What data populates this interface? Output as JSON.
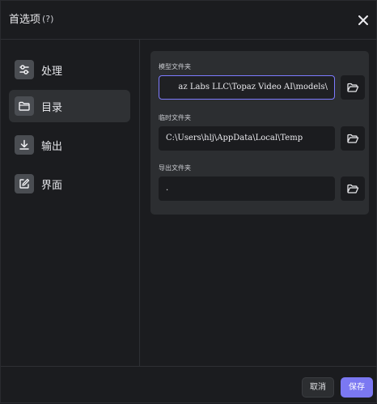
{
  "dialog": {
    "title": "首选项",
    "help": "(?)"
  },
  "sidebar": {
    "items": [
      {
        "label": "处理",
        "icon": "sliders-icon",
        "active": false
      },
      {
        "label": "目录",
        "icon": "folder-icon",
        "active": true
      },
      {
        "label": "输出",
        "icon": "download-icon",
        "active": false
      },
      {
        "label": "界面",
        "icon": "edit-square-icon",
        "active": false
      }
    ]
  },
  "directories": {
    "model_folder": {
      "label": "模型文件夹",
      "value": "az Labs LLC\\Topaz Video AI\\models\\"
    },
    "temp_folder": {
      "label": "临时文件夹",
      "value": "C:\\Users\\hlj\\AppData\\Local\\Temp"
    },
    "export_folder": {
      "label": "导出文件夹",
      "value": "."
    }
  },
  "footer": {
    "cancel_label": "取消",
    "save_label": "保存"
  },
  "colors": {
    "background": "#1b1c1f",
    "panel": "#2c2e31",
    "accent": "#7b78f2",
    "focus_border": "#7d7bff"
  }
}
